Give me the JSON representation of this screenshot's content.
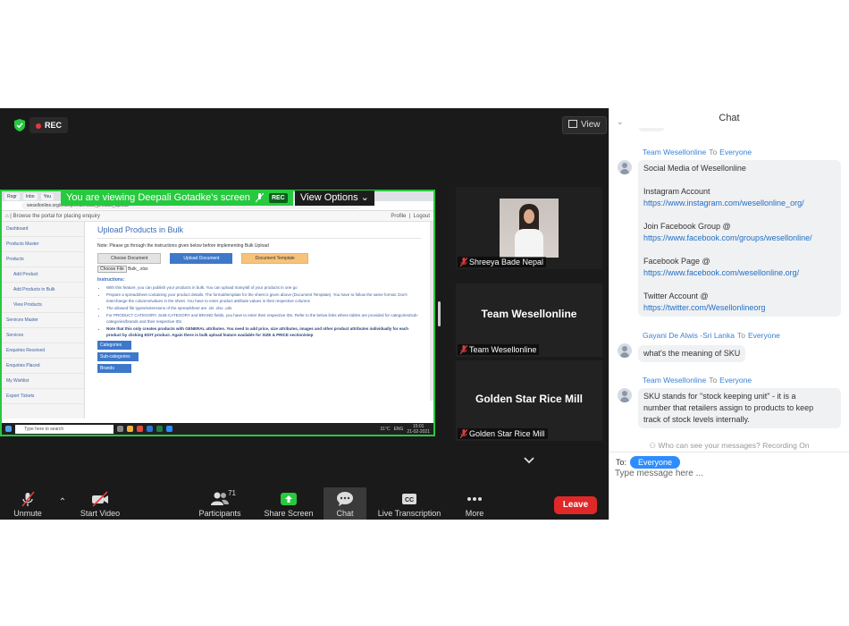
{
  "meeting": {
    "rec_label": "REC",
    "view_label": "View",
    "share_banner": "You are viewing Deepali Gotadke's screen",
    "share_rec": "REC",
    "view_options": "View Options"
  },
  "browser": {
    "tabs": [
      "Rogr",
      "Inbo",
      "You"
    ],
    "url": "wesellonline.org/enterprenuer/bulk_product_upload",
    "header_left": "Browse the portal for placing enquiry",
    "header_profile": "Profile",
    "header_logout": "Logout",
    "sidebar": [
      "Dashboard",
      "Products Master",
      "Products",
      "Add Product",
      "Add Products in Bulk",
      "View Products",
      "Services Master",
      "Services",
      "Enquiries Received",
      "Enquiries Placed",
      "My Wishlist",
      "Export Tickets"
    ],
    "page_title": "Upload Products in Bulk",
    "note": "Note: Please go through the instructions given below before implementing Bulk Upload",
    "btn_choose": "Choose Document",
    "btn_upload": "Upload Document",
    "btn_template": "Document Template",
    "file_button": "Choose File",
    "file_name": "Bulk_.xlsx",
    "instructions_heading": "Instructions:",
    "instructions": [
      "With this feature, you can publish your products in bulk. You can upload many/all of your products in one go",
      "Prepare a spreadsheet containing your product details. The format/template for the sheet is given above (Document Template). You have to follow the same format. Don't interchange the columns/values in the sheet. You have to enter product attribute values in their respective columns",
      "The allowed file types/extensions of the spreadsheet are .xls .xlsx .ods",
      "For PRODUCT CATEGORY, SUB-CATEGORY and BRAND fields, you have to enter their respective IDs. Refer to the below links where tables are provided for categories/sub-categories/brands and their respective IDs"
    ],
    "instruction_bold": "Note that this only creates products with GENERAL attributes. You need to add price, size attributes, images and other product attributes individually for each product by clicking EDIT product. Again there is bulk upload feature available for SIZE & PRICE section/step",
    "links": [
      "Categories",
      "Sub-categories",
      "Brands"
    ],
    "taskbar_search": "Type here to search",
    "taskbar_temp": "31°C",
    "taskbar_lang": "ENG",
    "taskbar_time": "15:01",
    "taskbar_date": "21-02-2021"
  },
  "participants_tiles": [
    {
      "name": "Shreeya Bade Nepal"
    },
    {
      "big": "Team Wesellonline",
      "name": "Team Wesellonline"
    },
    {
      "big": "Golden Star Rice Mill",
      "name": "Golden Star Rice Mill"
    }
  ],
  "toolbar": {
    "unmute": "Unmute",
    "start_video": "Start Video",
    "participants": "Participants",
    "participants_count": "71",
    "share_screen": "Share Screen",
    "chat": "Chat",
    "live_transcription": "Live Transcription",
    "more": "More",
    "leave": "Leave"
  },
  "chat": {
    "title": "Chat",
    "to_word": "To",
    "messages": [
      {
        "sender": "Team Wesellonline",
        "recipient": "Everyone",
        "lines": [
          "Social Media of Wesellonline",
          "",
          "Instagram Account",
          "https://www.instagram.com/wesellonline_org/",
          "",
          "Join Facebook Group @",
          "https://www.facebook.com/groups/wesellonline/",
          "",
          "Facebook Page @",
          "https://www.facebook.com/wesellonline.org/",
          "",
          "Twitter Account @",
          "https://twitter.com/Wesellonlineorg"
        ]
      },
      {
        "sender": "Gayani De Alwis -Sri Lanka",
        "recipient": "Everyone",
        "lines": [
          "what's the meaning of SKU"
        ]
      },
      {
        "sender": "Team Wesellonline",
        "recipient": "Everyone",
        "lines": [
          "SKU stands for \"stock keeping unit\" - it is a",
          "number that retailers assign to products to keep",
          "track of stock levels internally."
        ]
      }
    ],
    "privacy": "Who can see your messages? Recording On",
    "to_label": "To:",
    "to_value": "Everyone",
    "input_placeholder": "Type message here ..."
  }
}
